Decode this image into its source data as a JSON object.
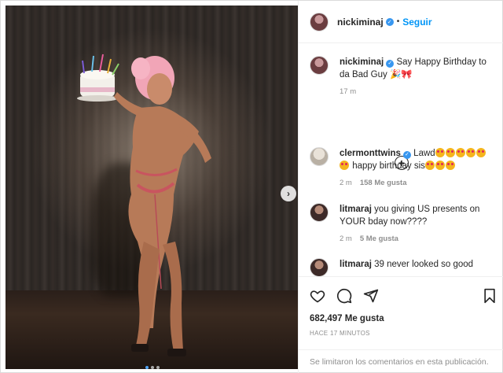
{
  "post": {
    "username": "nickiminaj",
    "follow_label": "Seguir",
    "separator": "•",
    "slide_count_dots": 3
  },
  "caption": {
    "username": "nickiminaj",
    "text": "Say Happy Birthday to da Bad Guy",
    "time": "17 m"
  },
  "comments": [
    {
      "username": "clermonttwins",
      "verified": true,
      "text_before": "Lawd",
      "text_after": "happy birthday sis",
      "time": "2 m",
      "likes": "158 Me gusta"
    },
    {
      "username": "litmaraj",
      "text": "you giving US presents on YOUR bday now????",
      "time": "2 m",
      "likes": "5 Me gusta"
    },
    {
      "username": "litmaraj",
      "text": "39 never looked so good"
    }
  ],
  "actions": {
    "likes": "682,497 Me gusta",
    "time": "HACE 17 MINUTOS",
    "comments_disabled": "Se limitaron los comentarios en esta publicación."
  },
  "icons": {
    "like": "heart-icon",
    "comment": "comment-icon",
    "share": "share-icon",
    "save": "bookmark-icon",
    "next": "chevron-right-icon",
    "more": "plus-circle-icon"
  },
  "colors": {
    "link_blue": "#0095f6",
    "verified_blue": "#3897f0",
    "muted": "#8e8e8e"
  }
}
